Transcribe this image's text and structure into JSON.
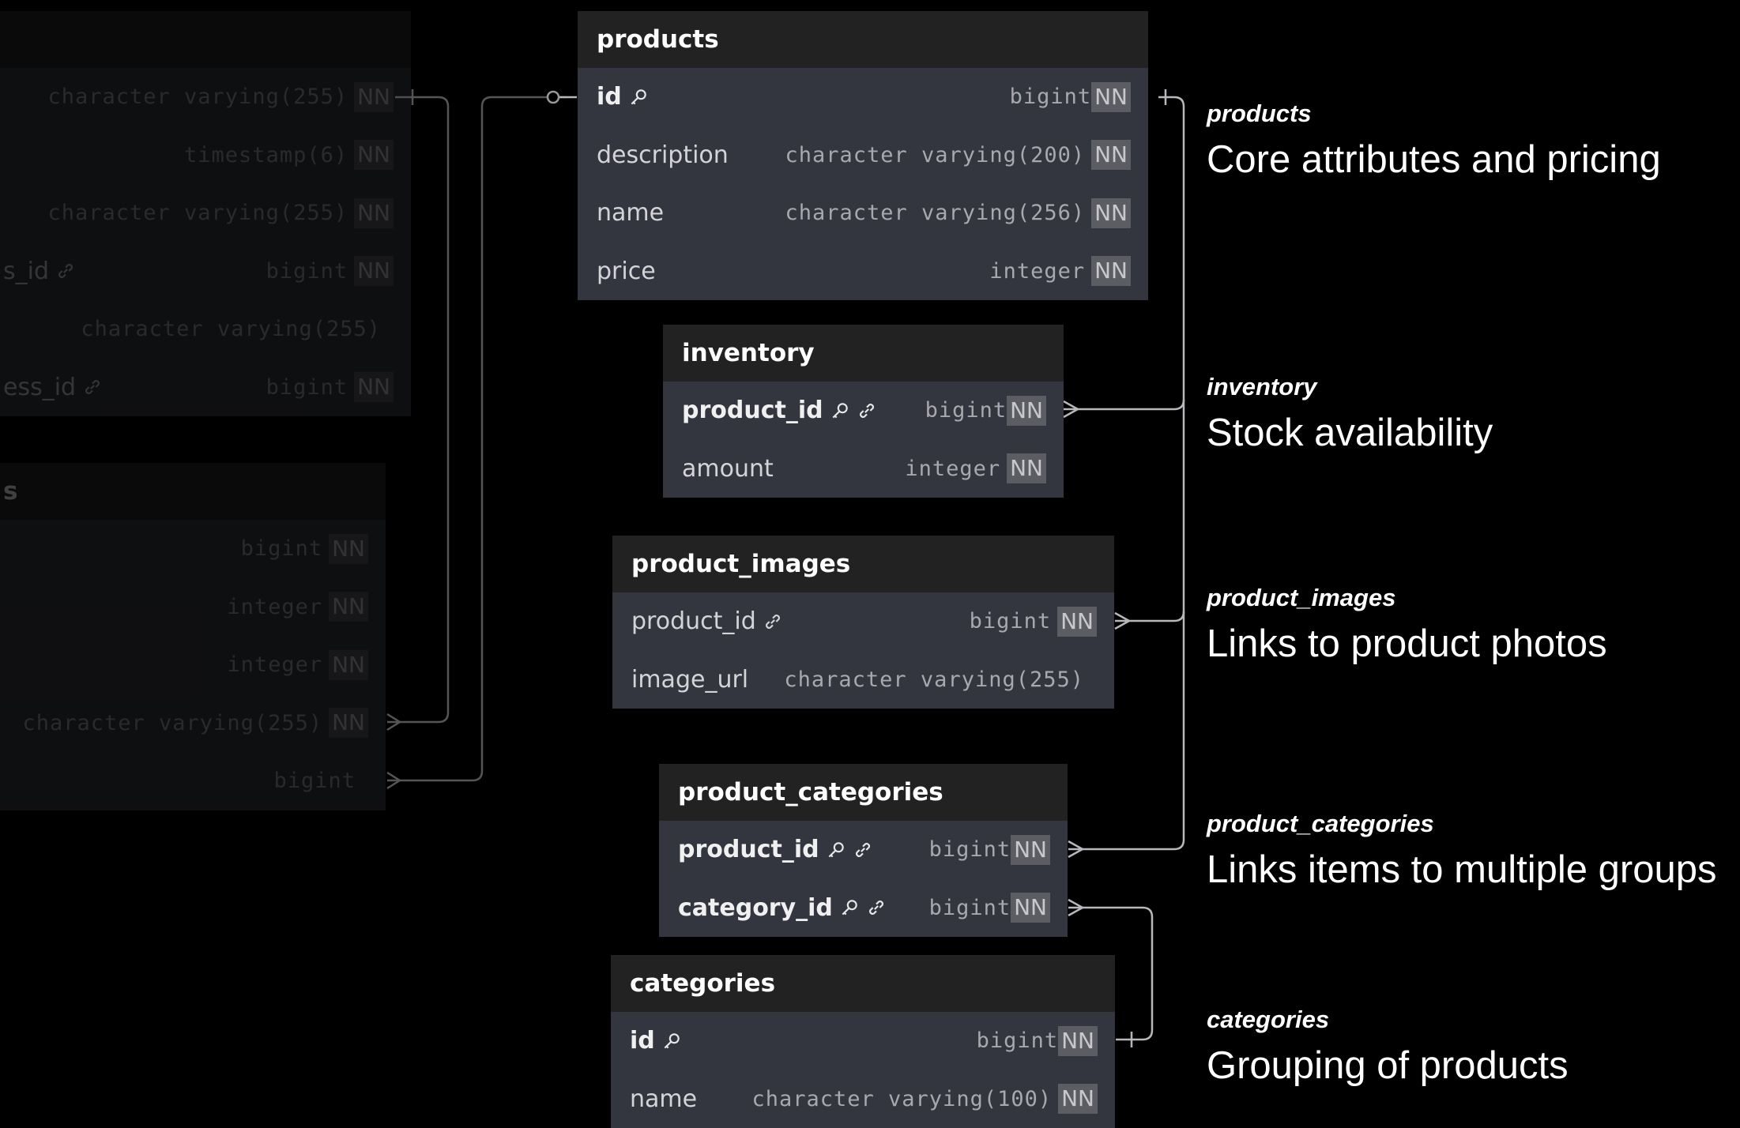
{
  "tables": {
    "products": {
      "title": "products",
      "rows": [
        {
          "name": "id",
          "type": "bigint",
          "nn": "NN"
        },
        {
          "name": "description",
          "type": "character varying(200)",
          "nn": "NN"
        },
        {
          "name": "name",
          "type": "character varying(256)",
          "nn": "NN"
        },
        {
          "name": "price",
          "type": "integer",
          "nn": "NN"
        }
      ]
    },
    "inventory": {
      "title": "inventory",
      "rows": [
        {
          "name": "product_id",
          "type": "bigint",
          "nn": "NN"
        },
        {
          "name": "amount",
          "type": "integer",
          "nn": "NN"
        }
      ]
    },
    "product_images": {
      "title": "product_images",
      "rows": [
        {
          "name": "product_id",
          "type": "bigint",
          "nn": "NN"
        },
        {
          "name": "image_url",
          "type": "character varying(255)",
          "nn": ""
        }
      ]
    },
    "product_categories": {
      "title": "product_categories",
      "rows": [
        {
          "name": "product_id",
          "type": "bigint",
          "nn": "NN"
        },
        {
          "name": "category_id",
          "type": "bigint",
          "nn": "NN"
        }
      ]
    },
    "categories": {
      "title": "categories",
      "rows": [
        {
          "name": "id",
          "type": "bigint",
          "nn": "NN"
        },
        {
          "name": "name",
          "type": "character varying(100)",
          "nn": "NN"
        }
      ]
    },
    "faded_a": {
      "rows": [
        {
          "name": "",
          "type": "character varying(255)",
          "nn": "NN"
        },
        {
          "name": "",
          "type": "timestamp(6)",
          "nn": "NN"
        },
        {
          "name": "",
          "type": "character varying(255)",
          "nn": "NN"
        },
        {
          "name": "s_id",
          "type": "bigint",
          "nn": "NN"
        },
        {
          "name": "",
          "type": "character varying(255)",
          "nn": ""
        },
        {
          "name": "ess_id",
          "type": "bigint",
          "nn": "NN"
        }
      ]
    },
    "faded_b": {
      "title": "s",
      "rows": [
        {
          "name": "",
          "type": "bigint",
          "nn": "NN"
        },
        {
          "name": "",
          "type": "integer",
          "nn": "NN"
        },
        {
          "name": "",
          "type": "integer",
          "nn": "NN"
        },
        {
          "name": "",
          "type": "character varying(255)",
          "nn": "NN"
        },
        {
          "name": "",
          "type": "bigint",
          "nn": ""
        }
      ]
    }
  },
  "notes": [
    {
      "title": "products",
      "desc": "Core attributes and pricing"
    },
    {
      "title": "inventory",
      "desc": "Stock availability"
    },
    {
      "title": "product_images",
      "desc": "Links to product photos"
    },
    {
      "title": "product_categories",
      "desc": "Links items to multiple groups"
    },
    {
      "title": "categories",
      "desc": "Grouping of products"
    }
  ],
  "colors": {
    "background": "#000000",
    "table_body": "#34363f",
    "table_header": "#222222",
    "nn_badge": "#5c5d63",
    "connector": "#b8b8bc"
  }
}
